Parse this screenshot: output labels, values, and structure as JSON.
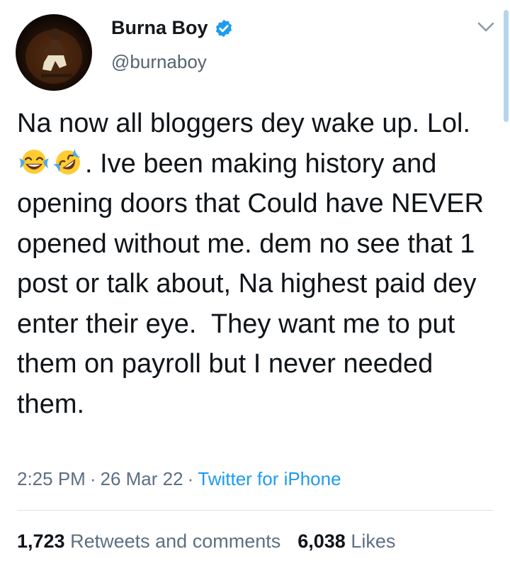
{
  "author": {
    "display_name": "Burna Boy",
    "handle": "@burnaboy",
    "verified_icon": "verified-badge-icon",
    "verified_color": "#1d9bf0"
  },
  "tweet": {
    "text_part1": "Na now all bloggers dey wake up. Lol. ",
    "emojis": [
      "face-with-tears-of-joy-emoji",
      "rolling-on-floor-laughing-emoji"
    ],
    "text_part2": ". Ive been making history and opening doors that Could have NEVER opened without me. dem no see that 1 post or talk about, Na highest paid dey enter their eye.  They want me to put them on payroll but I never needed them."
  },
  "meta": {
    "time": "2:25 PM",
    "separator": "·",
    "date": "26 Mar 22",
    "source": "Twitter for iPhone"
  },
  "stats": {
    "retweets_count": "1,723",
    "retweets_label": "Retweets and comments",
    "likes_count": "6,038",
    "likes_label": "Likes"
  },
  "colors": {
    "text": "#0f1419",
    "secondary": "#5b7083",
    "link": "#1d9bf0",
    "divider": "#dfe4e8"
  }
}
